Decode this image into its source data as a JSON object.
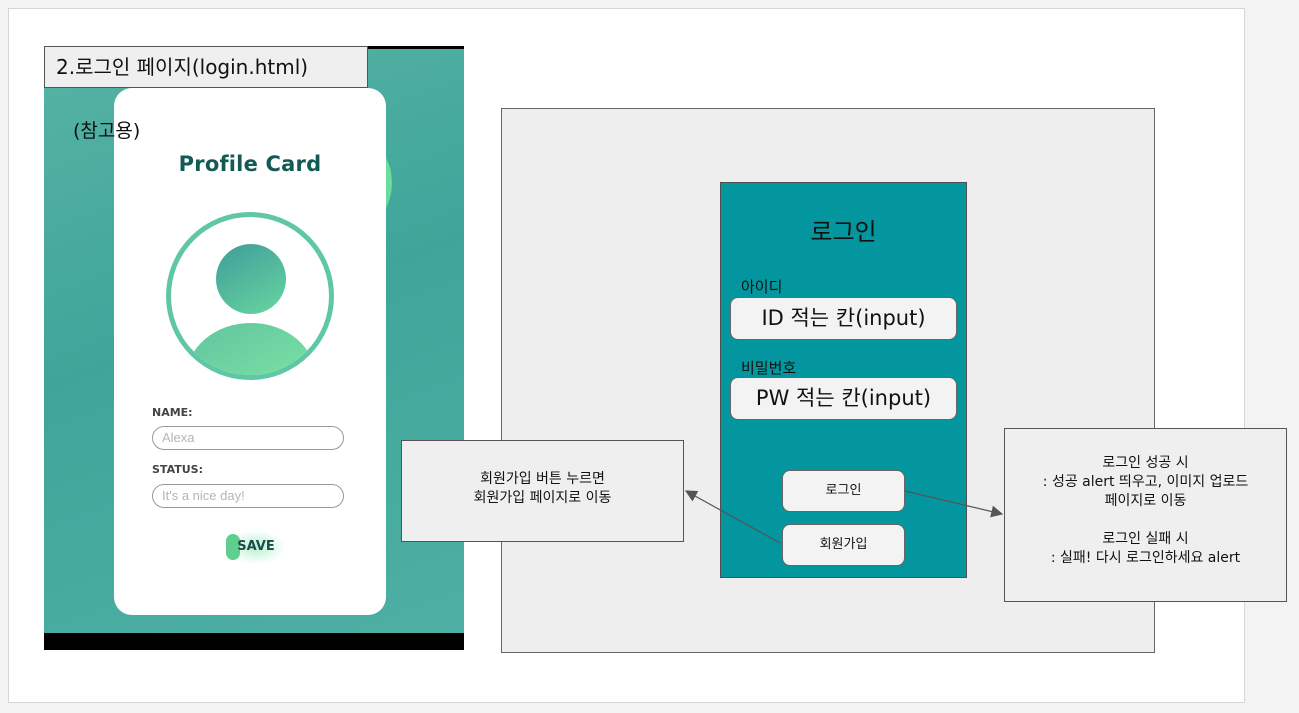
{
  "reference": {
    "caption": "2.로그인 페이지(login.html)",
    "note": "(참고용)",
    "card": {
      "title": "Profile Card",
      "name_label": "NAME:",
      "name_placeholder": "Alexa",
      "status_label": "STATUS:",
      "status_placeholder": "It's a nice day!",
      "save_label": "SAVE"
    },
    "colors": {
      "background": "#4fb0a4",
      "title": "#135a55",
      "accent": "#5fcf90"
    }
  },
  "wireframe": {
    "panel_color": "#03969e",
    "title": "로그인",
    "id_label": "아이디",
    "id_input": "ID 적는 칸(input)",
    "pw_label": "비밀번호",
    "pw_input": "PW 적는 칸(input)",
    "login_button": "로그인",
    "signup_button": "회원가입"
  },
  "notes": {
    "signup": [
      "회원가입 버튼 누르면",
      "회원가입 페이지로 이동"
    ],
    "login": [
      "로그인 성공 시",
      ": 성공 alert 띄우고, 이미지 업로드",
      "페이지로 이동",
      "",
      "로그인 실패 시",
      ": 실패! 다시 로그인하세요 alert"
    ]
  }
}
